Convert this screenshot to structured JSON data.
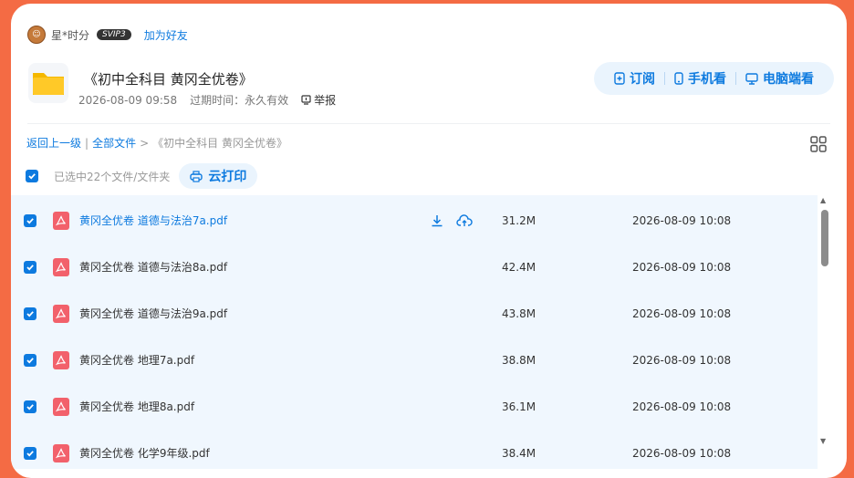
{
  "user": {
    "name": "星*时分",
    "badge": "SVIP3",
    "add_friend": "加为好友"
  },
  "folder": {
    "title": "《初中全科目 黄冈全优卷》",
    "date": "2026-08-09 09:58",
    "expiry": "过期时间：永久有效",
    "report": "举报"
  },
  "actions": {
    "subscribe": "订阅",
    "phone": "手机看",
    "pc": "电脑端看"
  },
  "breadcrumb": {
    "back": "返回上一级",
    "sep1": "|",
    "all": "全部文件",
    "sep2": ">",
    "current": "《初中全科目 黄冈全优卷》"
  },
  "selection": {
    "text": "已选中22个文件/文件夹",
    "print": "云打印"
  },
  "colors": {
    "accent": "#0d7adf",
    "background": "#f46b44",
    "row_bg": "#f0f7fe",
    "pdf": "#f2616b"
  },
  "files": [
    {
      "name": "黄冈全优卷 道德与法治7a.pdf",
      "size": "31.2M",
      "date": "2026-08-09 10:08",
      "checked": true
    },
    {
      "name": "黄冈全优卷 道德与法治8a.pdf",
      "size": "42.4M",
      "date": "2026-08-09 10:08",
      "checked": true
    },
    {
      "name": "黄冈全优卷 道德与法治9a.pdf",
      "size": "43.8M",
      "date": "2026-08-09 10:08",
      "checked": true
    },
    {
      "name": "黄冈全优卷 地理7a.pdf",
      "size": "38.8M",
      "date": "2026-08-09 10:08",
      "checked": true
    },
    {
      "name": "黄冈全优卷 地理8a.pdf",
      "size": "36.1M",
      "date": "2026-08-09 10:08",
      "checked": true
    },
    {
      "name": "黄冈全优卷 化学9年级.pdf",
      "size": "38.4M",
      "date": "2026-08-09 10:08",
      "checked": true
    }
  ]
}
